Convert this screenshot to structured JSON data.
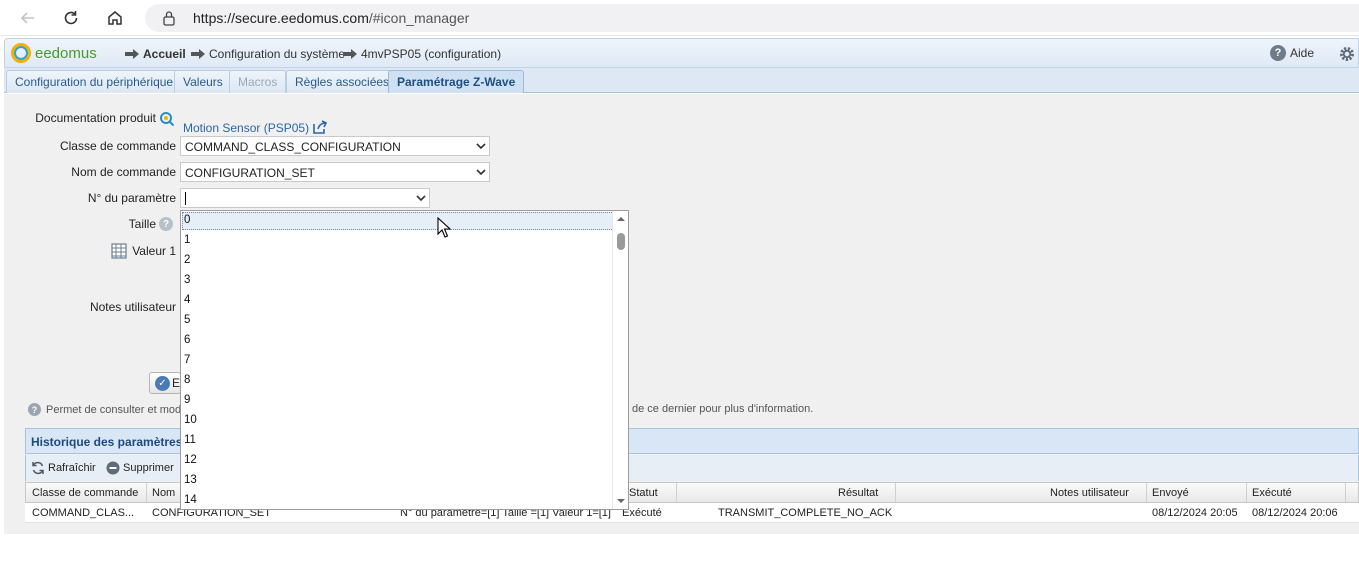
{
  "browser": {
    "url_host": "https://secure.eedomus.com",
    "url_path": "/#icon_manager"
  },
  "header": {
    "logo_text": "eedomus",
    "breadcrumb": [
      "Accueil",
      "Configuration du système",
      "4mvPSP05 (configuration)"
    ],
    "help_label": "Aide"
  },
  "tabs": [
    {
      "label": "Configuration du périphérique",
      "state": "normal"
    },
    {
      "label": "Valeurs",
      "state": "normal"
    },
    {
      "label": "Macros",
      "state": "disabled"
    },
    {
      "label": "Règles associées",
      "state": "normal"
    },
    {
      "label": "Paramétrage Z-Wave",
      "state": "active"
    }
  ],
  "form": {
    "doc_label": "Documentation produit",
    "doc_link": "Motion Sensor (PSP05)",
    "command_class_label": "Classe de commande",
    "command_class_value": "COMMAND_CLASS_CONFIGURATION",
    "command_name_label": "Nom de commande",
    "command_name_value": "CONFIGURATION_SET",
    "param_label": "N° du paramètre",
    "param_value": "",
    "size_label": "Taille",
    "value1_label": "Valeur 1",
    "notes_label": "Notes utilisateur",
    "save_label_visible": "E"
  },
  "info": {
    "text_start": "Permet de consulter et mod",
    "text_end": "de ce dernier pour plus d'information."
  },
  "dropdown": {
    "options": [
      "0",
      "1",
      "2",
      "3",
      "4",
      "5",
      "6",
      "7",
      "8",
      "9",
      "10",
      "11",
      "12",
      "13",
      "14"
    ],
    "highlighted": "0"
  },
  "history": {
    "title": "Historique des paramètres",
    "toolbar": [
      "Rafraîchir",
      "Supprimer"
    ],
    "columns": [
      "Classe de commande",
      "Nom",
      "Statut",
      "Résultat",
      "Notes utilisateur",
      "Envoyé",
      "Exécuté"
    ],
    "rows": [
      {
        "command_class": "COMMAND_CLAS...",
        "command_name": "CONFIGURATION_SET",
        "params": "N° du paramètre=[1] Taille =[1] Valeur 1=[1]",
        "status": "Exécuté",
        "result": "TRANSMIT_COMPLETE_NO_ACK",
        "notes": "",
        "sent": "08/12/2024 20:05",
        "executed": "08/12/2024 20:06"
      }
    ]
  },
  "colors": {
    "accent_blue": "#2a66a8",
    "tab_active_bg": "#cfe0f3",
    "header_bg": "#dfe9f5"
  }
}
